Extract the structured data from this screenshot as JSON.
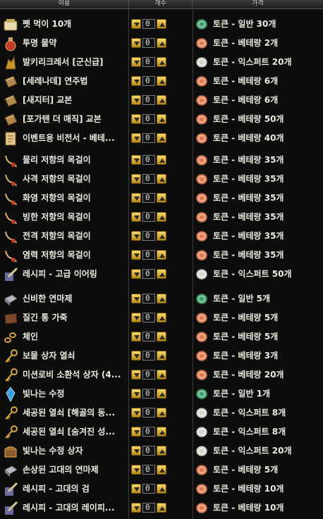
{
  "header": {
    "name": "이름",
    "count": "개수",
    "price": "가격"
  },
  "colors": {
    "general": "#3fa06a",
    "veterang": "#e07a50",
    "expert": "#d9d6cf"
  },
  "items": [
    {
      "icon": "pet-food-icon",
      "name": "펫 먹이 10개",
      "qty": "0",
      "coin": "general",
      "price": "토큰 - 일반 30개"
    },
    {
      "icon": "potion-icon",
      "name": "투명 물약",
      "qty": "0",
      "coin": "veterang",
      "price": "토큰 - 베테랑 2개"
    },
    {
      "icon": "figure-icon",
      "name": "발키리크레서 [군신급]",
      "qty": "0",
      "coin": "expert",
      "price": "토큰 - 익스퍼트 20개"
    },
    {
      "icon": "book-icon",
      "name": "[세레나데] 연주법",
      "qty": "0",
      "coin": "veterang",
      "price": "토큰 - 베테랑 6개"
    },
    {
      "icon": "book-icon",
      "name": "[새지터] 교본",
      "qty": "0",
      "coin": "veterang",
      "price": "토큰 - 베테랑 6개"
    },
    {
      "icon": "book-icon",
      "name": "[포가텐 더 매직] 교본",
      "qty": "0",
      "coin": "veterang",
      "price": "토큰 - 베테랑 50개"
    },
    {
      "icon": "scroll-icon",
      "name": "이벤트용 비전서 - 베테...",
      "qty": "0",
      "coin": "veterang",
      "price": "토큰 - 베테랑 40개"
    },
    {
      "icon": "necklace-icon",
      "name": "물리 저항의 목걸이",
      "qty": "0",
      "coin": "veterang",
      "price": "토큰 - 베테랑 35개"
    },
    {
      "icon": "necklace-icon",
      "name": "사격 저항의 목걸이",
      "qty": "0",
      "coin": "veterang",
      "price": "토큰 - 베테랑 35개"
    },
    {
      "icon": "necklace-icon",
      "name": "화염 저항의 목걸이",
      "qty": "0",
      "coin": "veterang",
      "price": "토큰 - 베테랑 35개"
    },
    {
      "icon": "necklace-icon",
      "name": "빙한 저항의 목걸이",
      "qty": "0",
      "coin": "veterang",
      "price": "토큰 - 베테랑 35개"
    },
    {
      "icon": "necklace-icon",
      "name": "전격 저항의 목걸이",
      "qty": "0",
      "coin": "veterang",
      "price": "토큰 - 베테랑 35개"
    },
    {
      "icon": "necklace-icon",
      "name": "염력 저항의 목걸이",
      "qty": "0",
      "coin": "veterang",
      "price": "토큰 - 베테랑 35개"
    },
    {
      "icon": "recipe-icon",
      "name": "레시피 - 고급 이어링",
      "qty": "0",
      "coin": "expert",
      "price": "토큰 - 익스퍼트 50개"
    },
    {
      "icon": "polish-icon",
      "name": "신비한 연마제",
      "qty": "0",
      "coin": "general",
      "price": "토큰 - 일반 5개"
    },
    {
      "icon": "leather-icon",
      "name": "질긴 통 가죽",
      "qty": "0",
      "coin": "veterang",
      "price": "토큰 - 베테랑 5개"
    },
    {
      "icon": "chain-icon",
      "name": "체인",
      "qty": "0",
      "coin": "veterang",
      "price": "토큰 - 베테랑 5개"
    },
    {
      "icon": "key-icon",
      "name": "보물 상자 열쇠",
      "qty": "0",
      "coin": "veterang",
      "price": "토큰 - 베테랑 3개"
    },
    {
      "icon": "key-icon",
      "name": "미션로비 소환석 상자 (4...",
      "qty": "0",
      "coin": "veterang",
      "price": "토큰 - 베테랑 20개"
    },
    {
      "icon": "crystal-icon",
      "name": "빛나는 수정",
      "qty": "0",
      "coin": "general",
      "price": "토큰 - 일반 1개"
    },
    {
      "icon": "key-icon",
      "name": "세공된 열쇠 [해골의 동...",
      "qty": "0",
      "coin": "expert",
      "price": "토큰 - 익스퍼트 8개"
    },
    {
      "icon": "key-icon",
      "name": "세공된 열쇠 [숨겨진 성...",
      "qty": "0",
      "coin": "expert",
      "price": "토큰 - 익스퍼트 8개"
    },
    {
      "icon": "chest-icon",
      "name": "빛나는 수정 상자",
      "qty": "0",
      "coin": "expert",
      "price": "토큰 - 익스퍼트 20개"
    },
    {
      "icon": "polish-icon",
      "name": "손상된 고대의 연마제",
      "qty": "0",
      "coin": "veterang",
      "price": "토큰 - 베테랑 5개"
    },
    {
      "icon": "recipe-icon",
      "name": "레시피 - 고대의 검",
      "qty": "0",
      "coin": "veterang",
      "price": "토큰 - 베테랑 10개"
    },
    {
      "icon": "recipe-icon",
      "name": "레시피 - 고대의 레이피...",
      "qty": "0",
      "coin": "veterang",
      "price": "토큰 - 베테랑 10개"
    }
  ]
}
